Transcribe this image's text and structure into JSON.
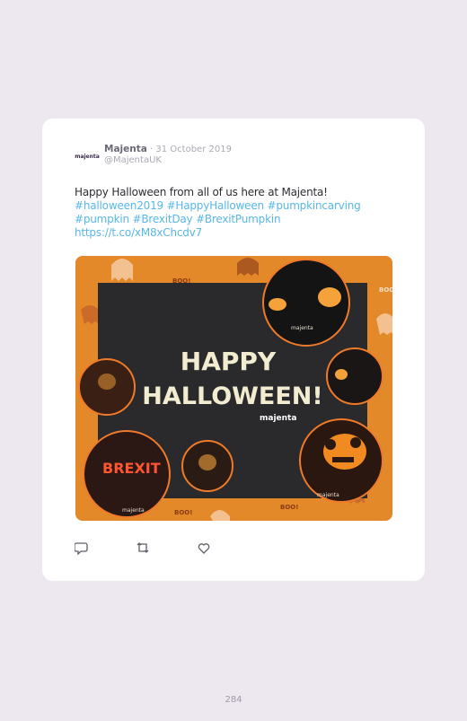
{
  "tweet": {
    "author_name": "Majenta",
    "separator": " · ",
    "date": "31 October 2019",
    "handle": "@MajentaUK",
    "logo_text": "majenta",
    "text_line1": "Happy Halloween from all of us here at Majenta!",
    "hashtags_line1": "#halloween2019 #HappyHalloween #pumpkincarving",
    "hashtags_line2": "#pumpkin #BrexitDay #BrexitPumpkin",
    "link": "https://t.co/xM8xChcdv7"
  },
  "media": {
    "headline_line1": "HAPPY",
    "headline_line2": "HALLOWEEN!",
    "brand": "majenta",
    "boo": "BOO!",
    "pumpkin_word": "BREXIT",
    "pumpkin_brand": "majenta"
  },
  "actions": {
    "reply_icon": "reply-icon",
    "retweet_icon": "retweet-icon",
    "like_icon": "heart-icon"
  },
  "page_number": "284",
  "colors": {
    "link": "#58b7e8",
    "background": "#ede7ef",
    "media_orange": "#e4892a",
    "media_board": "#2a2a2c"
  }
}
